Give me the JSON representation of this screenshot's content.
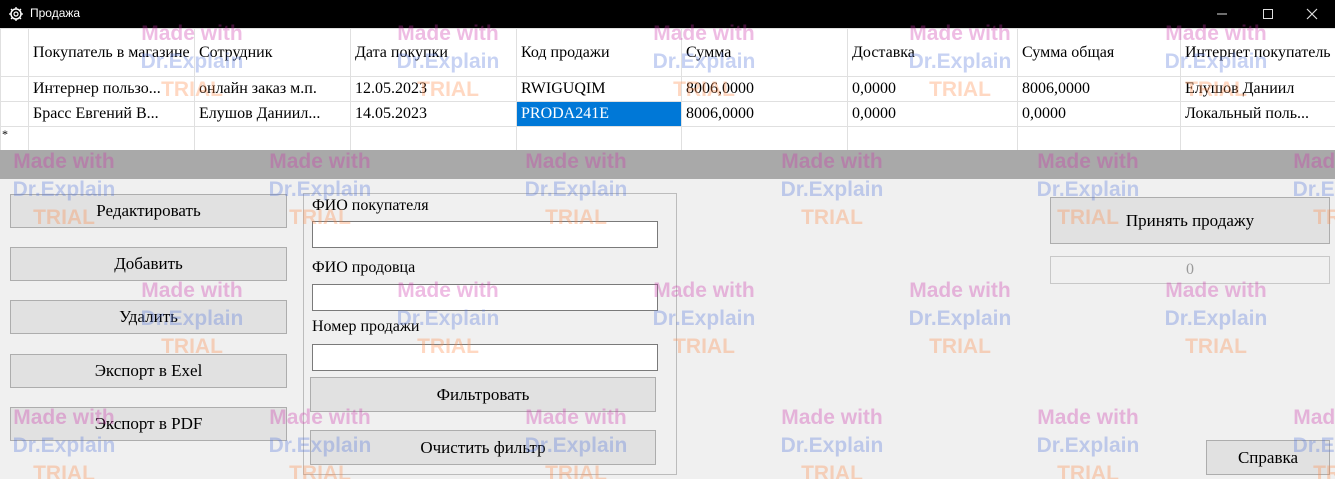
{
  "window": {
    "title": "Продажа",
    "minimize_icon": "minimize-icon",
    "maximize_icon": "maximize-icon",
    "close_icon": "close-icon"
  },
  "grid": {
    "columns": [
      "",
      "Покупатель в магазине",
      "Сотрудник",
      "Дата покупки",
      "Код продажи",
      "Сумма",
      "Доставка",
      "Сумма общая",
      "Интернет покупатель"
    ],
    "rows": [
      [
        "",
        "Интернер пользо...",
        "онлайн заказ м.п.",
        "12.05.2023",
        "RWIGUQIM",
        "8006,0000",
        "0,0000",
        "8006,0000",
        "Елушов Даниил"
      ],
      [
        "",
        "Брасс Евгений В...",
        "Елушов Даниил...",
        "14.05.2023",
        "PRODA241E",
        "8006,0000",
        "0,0000",
        "0,0000",
        "Локальный поль..."
      ]
    ],
    "new_row_marker": "*"
  },
  "buttons": {
    "edit": "Редактировать",
    "add": "Добавить",
    "delete": "Удалить",
    "export_excel": "Экспорт в Exel",
    "export_pdf": "Экспорт в PDF",
    "filter": "Фильтровать",
    "clear_filter": "Очистить фильтр",
    "accept_sale": "Принять продажу",
    "help": "Справка"
  },
  "filter": {
    "buyer_label": "ФИО покупателя",
    "buyer_value": "",
    "seller_label": "ФИО продовца",
    "seller_value": "",
    "number_label": "Номер продажи",
    "number_value": ""
  },
  "counter_value": "0",
  "watermark": {
    "line1": "Made with",
    "line2": "Dr.Explain",
    "line3": "TRIAL"
  },
  "colors": {
    "selection": "#0078d7",
    "titlebar": "#000000",
    "grid_gap": "#a9a9a9"
  }
}
